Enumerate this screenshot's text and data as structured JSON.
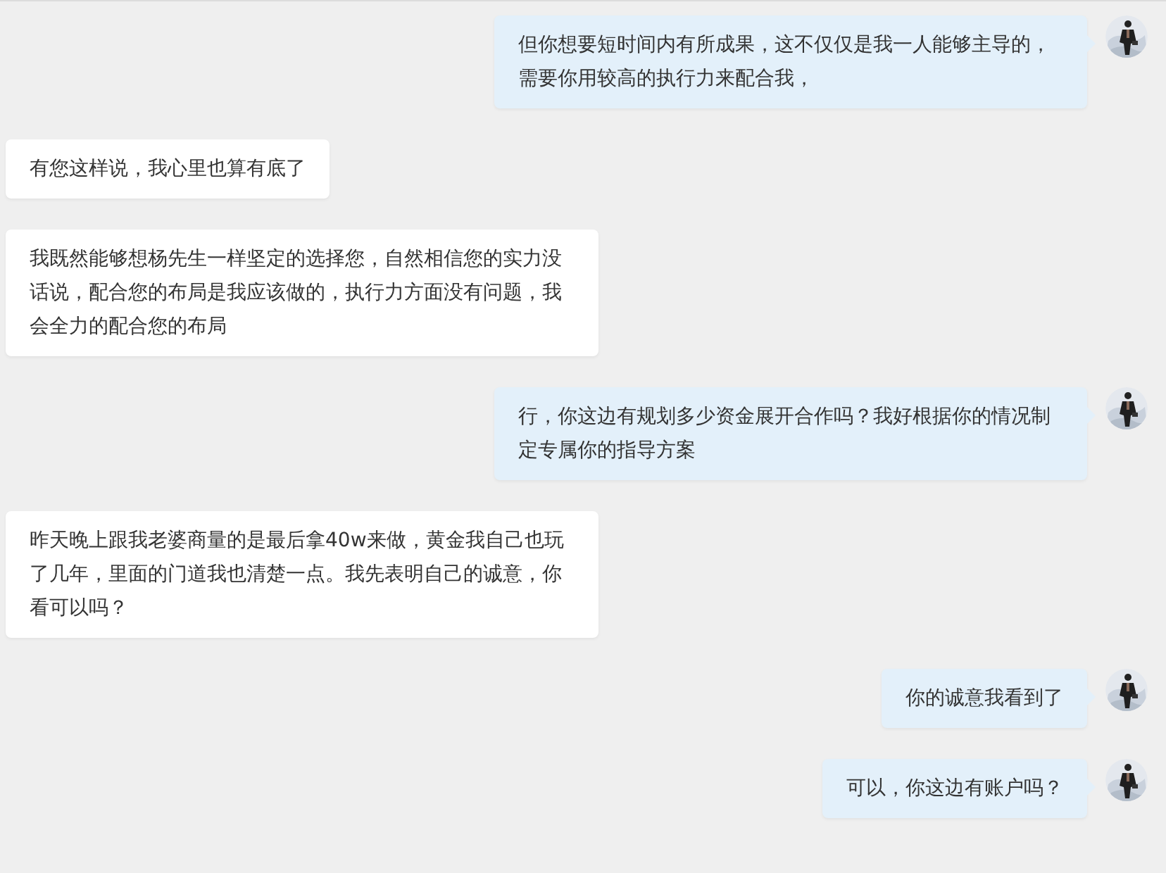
{
  "messages": [
    {
      "kind": "sent",
      "text": "但你想要短时间内有所成果，这不仅仅是我一人能够主导的，需要你用较高的执行力来配合我，"
    },
    {
      "kind": "received",
      "text": "有您这样说，我心里也算有底了"
    },
    {
      "kind": "received",
      "text": "我既然能够想杨先生一样坚定的选择您，自然相信您的实力没话说，配合您的布局是我应该做的，执行力方面没有问题，我会全力的配合您的布局"
    },
    {
      "kind": "sent",
      "text": "行，你这边有规划多少资金展开合作吗？我好根据你的情况制定专属你的指导方案"
    },
    {
      "kind": "received",
      "text": "昨天晚上跟我老婆商量的是最后拿40w来做，黄金我自己也玩了几年，里面的门道我也清楚一点。我先表明自己的诚意，你看可以吗？"
    },
    {
      "kind": "sent",
      "text": "你的诚意我看到了"
    },
    {
      "kind": "sent",
      "text": "可以，你这边有账户吗？"
    }
  ]
}
